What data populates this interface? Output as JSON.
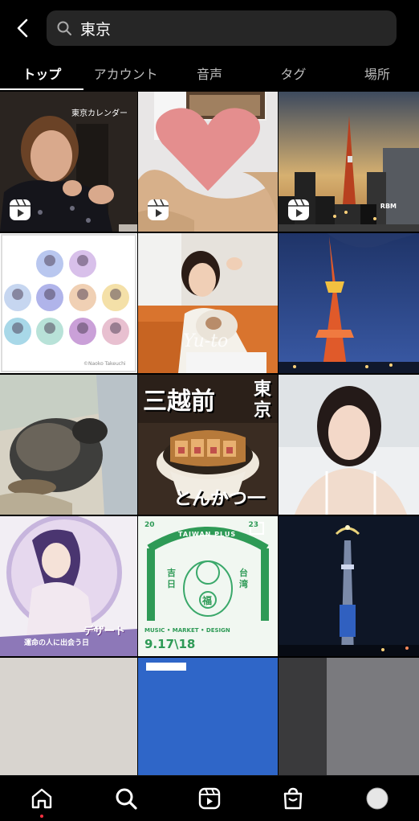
{
  "search": {
    "query": "東京"
  },
  "tabs": [
    {
      "label": "トップ",
      "active": true
    },
    {
      "label": "アカウント",
      "active": false
    },
    {
      "label": "音声",
      "active": false
    },
    {
      "label": "タグ",
      "active": false
    },
    {
      "label": "場所",
      "active": false
    }
  ],
  "tiles": {
    "t1": {
      "caption": "東京カレンダー",
      "reel": true
    },
    "t2": {
      "reel": true
    },
    "t3": {
      "sign": "RBM",
      "reel": true
    },
    "t4": {
      "credit": "©Naoko Takeuchi"
    },
    "t5": {
      "watermark": "Yu-to"
    },
    "t7_title_left": "三越前",
    "t7_title_right": "東京",
    "t7_bottom": "とんかつ一",
    "t10": {
      "title": "デザート",
      "sub": "運命の人に出会う日"
    },
    "t11": {
      "year_left": "20",
      "year_right": "23",
      "brand": "TAIWAN PLUS",
      "left_vert": "吉日",
      "right_vert": "台湾",
      "center": "福",
      "tags": "MUSIC  •  MARKET  •  DESIGN",
      "dates": "9.17\\18"
    }
  },
  "nav": [
    "home-icon",
    "search-icon",
    "reels-icon",
    "shop-icon",
    "profile-avatar"
  ],
  "colors": {
    "background": "#000000",
    "search_bg": "#262626",
    "notification_dot": "#ff3040"
  }
}
